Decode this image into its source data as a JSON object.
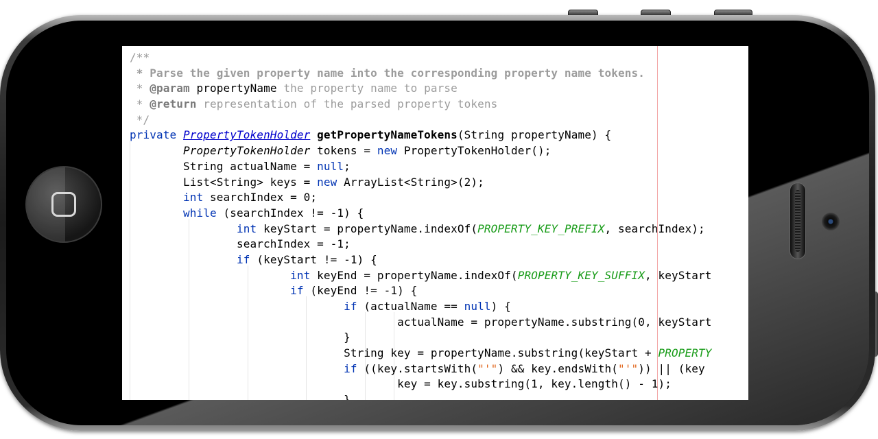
{
  "device": {
    "buttons": [
      "home-button",
      "power-button",
      "volume-up",
      "volume-down",
      "mute-switch"
    ],
    "home_icon": "square-home-icon"
  },
  "code": {
    "lines": [
      [
        {
          "t": "/**",
          "c": "cm"
        }
      ],
      [
        {
          "t": " * Parse the given property name into the corresponding property name tokens.",
          "c": "cmb"
        }
      ],
      [
        {
          "t": " * ",
          "c": "cm"
        },
        {
          "t": "@param",
          "c": "tag"
        },
        {
          "t": " propertyName",
          "c": ""
        },
        {
          "t": " the property name to parse",
          "c": "cm"
        }
      ],
      [
        {
          "t": " * ",
          "c": "cm"
        },
        {
          "t": "@return",
          "c": "tag"
        },
        {
          "t": " representation of the parsed property tokens",
          "c": "cm"
        }
      ],
      [
        {
          "t": " */",
          "c": "cm"
        }
      ],
      [
        {
          "t": "private ",
          "c": "kw"
        },
        {
          "t": "PropertyTokenHolder",
          "c": "ty-link"
        },
        {
          "t": " ",
          "c": ""
        },
        {
          "t": "getPropertyNameTokens",
          "c": "fn"
        },
        {
          "t": "(String propertyName) {",
          "c": ""
        }
      ],
      [
        {
          "t": "        ",
          "c": ""
        },
        {
          "t": "PropertyTokenHolder",
          "c": "ty"
        },
        {
          "t": " tokens = ",
          "c": ""
        },
        {
          "t": "new",
          "c": "kw"
        },
        {
          "t": " PropertyTokenHolder();",
          "c": ""
        }
      ],
      [
        {
          "t": "        String actualName = ",
          "c": ""
        },
        {
          "t": "null",
          "c": "kw"
        },
        {
          "t": ";",
          "c": ""
        }
      ],
      [
        {
          "t": "        List<String> keys = ",
          "c": ""
        },
        {
          "t": "new",
          "c": "kw"
        },
        {
          "t": " ArrayList<String>(2);",
          "c": ""
        }
      ],
      [
        {
          "t": "        ",
          "c": ""
        },
        {
          "t": "int",
          "c": "kw"
        },
        {
          "t": " searchIndex = 0;",
          "c": ""
        }
      ],
      [
        {
          "t": "        ",
          "c": ""
        },
        {
          "t": "while",
          "c": "kw"
        },
        {
          "t": " (searchIndex != -1) {",
          "c": ""
        }
      ],
      [
        {
          "t": "                ",
          "c": ""
        },
        {
          "t": "int",
          "c": "kw"
        },
        {
          "t": " keyStart = propertyName.indexOf(",
          "c": ""
        },
        {
          "t": "PROPERTY_KEY_PREFIX",
          "c": "const"
        },
        {
          "t": ", searchIndex);",
          "c": ""
        }
      ],
      [
        {
          "t": "                searchIndex = -1;",
          "c": ""
        }
      ],
      [
        {
          "t": "                ",
          "c": ""
        },
        {
          "t": "if",
          "c": "kw"
        },
        {
          "t": " (keyStart != -1) {",
          "c": ""
        }
      ],
      [
        {
          "t": "                        ",
          "c": ""
        },
        {
          "t": "int",
          "c": "kw"
        },
        {
          "t": " keyEnd = propertyName.indexOf(",
          "c": ""
        },
        {
          "t": "PROPERTY_KEY_SUFFIX",
          "c": "const"
        },
        {
          "t": ", keyStart",
          "c": ""
        }
      ],
      [
        {
          "t": "                        ",
          "c": ""
        },
        {
          "t": "if",
          "c": "kw"
        },
        {
          "t": " (keyEnd != -1) {",
          "c": ""
        }
      ],
      [
        {
          "t": "                                ",
          "c": ""
        },
        {
          "t": "if",
          "c": "kw"
        },
        {
          "t": " (actualName == ",
          "c": ""
        },
        {
          "t": "null",
          "c": "kw"
        },
        {
          "t": ") {",
          "c": ""
        }
      ],
      [
        {
          "t": "                                        actualName = propertyName.substring(0, keyStart",
          "c": ""
        }
      ],
      [
        {
          "t": "                                }",
          "c": ""
        }
      ],
      [
        {
          "t": "                                String key = propertyName.substring(keyStart + ",
          "c": ""
        },
        {
          "t": "PROPERTY",
          "c": "const"
        }
      ],
      [
        {
          "t": "                                ",
          "c": ""
        },
        {
          "t": "if",
          "c": "kw"
        },
        {
          "t": " ((key.startsWith(",
          "c": ""
        },
        {
          "t": "\"'\"",
          "c": "str"
        },
        {
          "t": ") && key.endsWith(",
          "c": ""
        },
        {
          "t": "\"'\"",
          "c": "str"
        },
        {
          "t": ")) || (key",
          "c": ""
        }
      ],
      [
        {
          "t": "                                        key = key.substring(1, key.length() - 1);",
          "c": ""
        }
      ],
      [
        {
          "t": "                                }",
          "c": ""
        }
      ]
    ]
  }
}
